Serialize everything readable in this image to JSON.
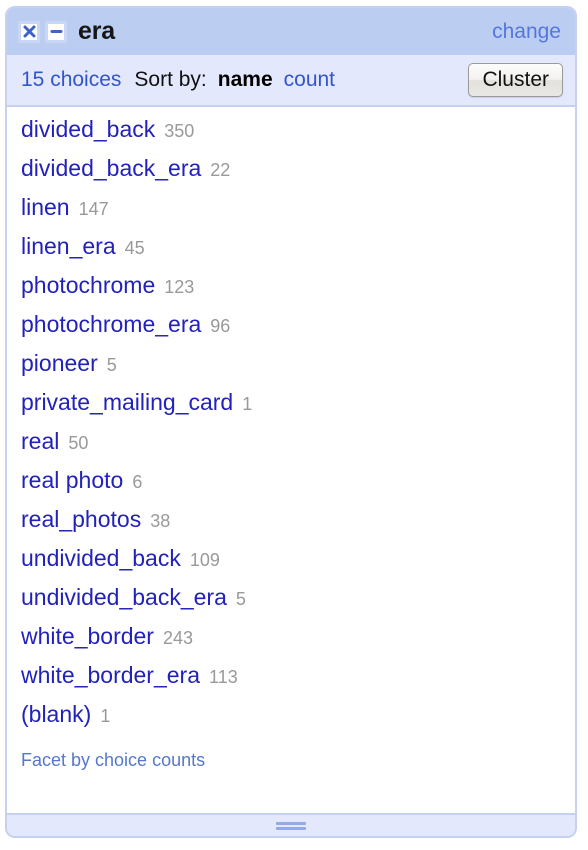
{
  "panel": {
    "title": "era",
    "change_link": "change",
    "close_icon": "close-icon",
    "minimize_icon": "minimize-icon"
  },
  "subheader": {
    "choices_label": "15 choices",
    "sort_by_label": "Sort by:",
    "sort_name": "name",
    "sort_count": "count",
    "cluster_label": "Cluster"
  },
  "choices": [
    {
      "label": "divided_back",
      "count": "350"
    },
    {
      "label": "divided_back_era",
      "count": "22"
    },
    {
      "label": "linen",
      "count": "147"
    },
    {
      "label": "linen_era",
      "count": "45"
    },
    {
      "label": "photochrome",
      "count": "123"
    },
    {
      "label": "photochrome_era",
      "count": "96"
    },
    {
      "label": "pioneer",
      "count": "5"
    },
    {
      "label": "private_mailing_card",
      "count": "1"
    },
    {
      "label": "real",
      "count": "50"
    },
    {
      "label": "real photo",
      "count": "6"
    },
    {
      "label": "real_photos",
      "count": "38"
    },
    {
      "label": "undivided_back",
      "count": "109"
    },
    {
      "label": "undivided_back_era",
      "count": "5"
    },
    {
      "label": "white_border",
      "count": "243"
    },
    {
      "label": "white_border_era",
      "count": "113"
    },
    {
      "label": "(blank)",
      "count": "1"
    }
  ],
  "footer": {
    "facet_link": "Facet by choice counts"
  },
  "colors": {
    "title_bar": "#bccdf2",
    "subheader": "#e4e8fc",
    "border": "#c6d0f0",
    "choice_label": "#2222bb",
    "choice_count": "#999999",
    "link": "#3355cc",
    "soft_link": "#5577cc"
  }
}
